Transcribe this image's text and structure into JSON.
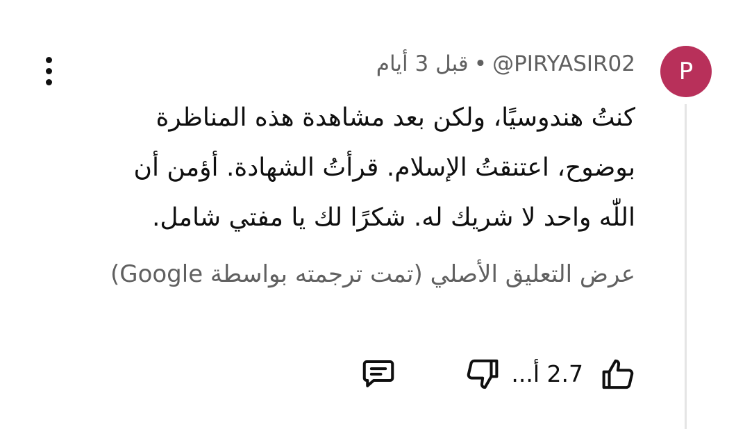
{
  "comment": {
    "avatar_letter": "P",
    "handle": "@PIRYASIR02",
    "separator": "•",
    "time_ago": "قبل 3 أيام",
    "text": "كنتُ هندوسيًا، ولكن بعد مشاهدة هذه المناظرة بوضوح، اعتنقتُ الإسلام. قرأتُ الشهادة. أؤمن أن اللّٰه واحد لا شريك له. شكرًا لك يا مفتي شامل.",
    "translate_link": "عرض التعليق الأصلي (تمت ترجمته بواسطة Google)",
    "like_count": "2.7 أ...",
    "avatar_color": "#b8305a"
  },
  "icons": {
    "menu": "more-vert-icon",
    "like": "thumb-up-icon",
    "dislike": "thumb-down-icon",
    "reply": "comment-icon"
  }
}
